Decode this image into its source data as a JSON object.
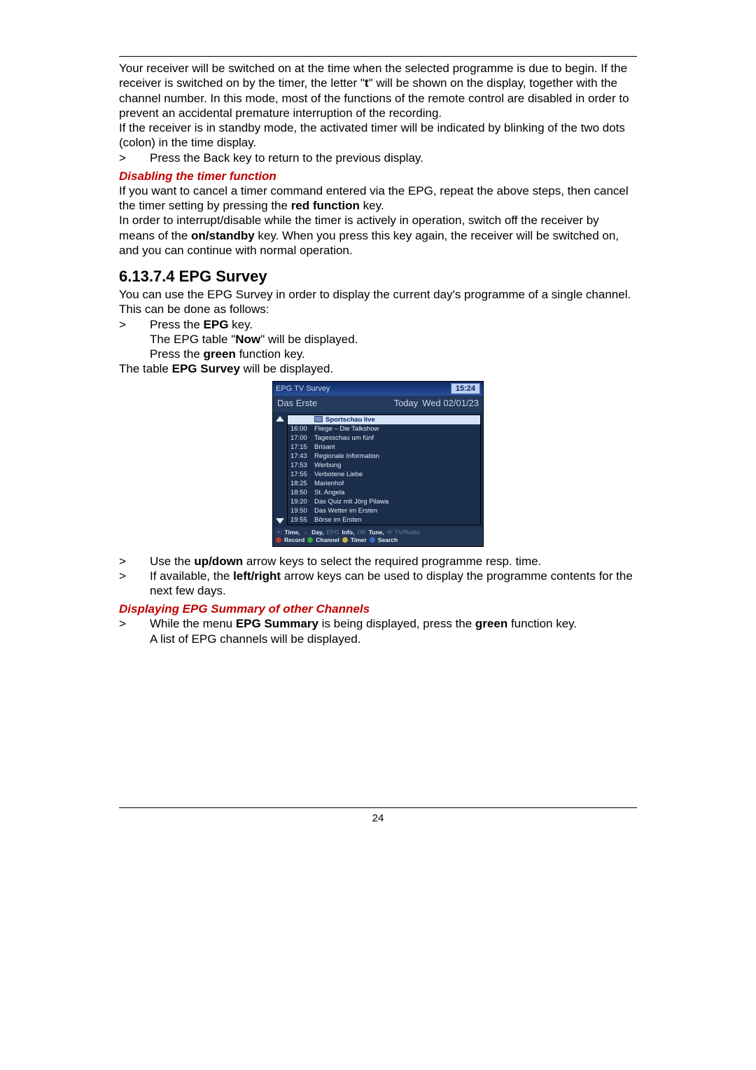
{
  "page_number": "24",
  "para1": "Your receiver will be switched on at the time when the selected programme is due to begin. If the receiver is switched on by the timer, the letter \"",
  "para1_bold_t": "t",
  "para1_after": "\" will be shown on the display, together with the channel number. In this mode, most of the functions of the remote control are disabled in order to prevent an accidental premature interruption of the recording.",
  "para2": "If the receiver is in standby mode, the activated timer will be indicated by blinking of the two dots (colon) in the time display.",
  "back_key_line": "Press the Back key to return to the previous display.",
  "disable_heading": "Disabling the timer function",
  "disable_p1a": "If you want to cancel a timer command entered via the EPG, repeat the above steps, then cancel the timer setting by pressing the ",
  "disable_p1_red": "red function",
  "disable_p1b": " key.",
  "disable_p2a": "In order to interrupt/disable while the timer is actively in operation, switch off the receiver by means of the ",
  "disable_p2_on": "on/standby",
  "disable_p2b": " key. When you press this key again, the receiver will be switched on, and you can continue with normal operation.",
  "section_no": "6.13.7.4 EPG Survey",
  "survey_intro": "You can use the EPG Survey in order to display the current day's programme of a single channel. This can be done as follows:",
  "press_epg_a": "Press the ",
  "press_epg_b": "EPG",
  "press_epg_c": " key.",
  "epg_now_a": "The EPG table \"",
  "epg_now_b": "Now",
  "epg_now_c": "\" will be displayed.",
  "press_green_a": "Press the ",
  "press_green_b": "green",
  "press_green_c": " function key.",
  "table_disp_a": "The table ",
  "table_disp_b": "EPG Survey",
  "table_disp_c": " will be displayed.",
  "epg": {
    "title": "EPG TV Survey",
    "clock": "15:24",
    "channel": "Das Erste",
    "today": "Today",
    "date": "Wed 02/01/23",
    "rows": [
      {
        "time": "",
        "title": "Sportschau live",
        "hl": true
      },
      {
        "time": "16:00",
        "title": "Fliege – Die Talkshow"
      },
      {
        "time": "17:00",
        "title": "Tagesschau um fünf"
      },
      {
        "time": "17:15",
        "title": "Brisant"
      },
      {
        "time": "17:43",
        "title": "Regionale Information"
      },
      {
        "time": "17:53",
        "title": "Werbung"
      },
      {
        "time": "17:55",
        "title": "Verbotene Liebe"
      },
      {
        "time": "18:25",
        "title": "Marienhof"
      },
      {
        "time": "18:50",
        "title": "St. Angela"
      },
      {
        "time": "19:20",
        "title": "Das Quiz mit Jörg Pilawa"
      },
      {
        "time": "19:50",
        "title": "Das Wetter im Ersten"
      },
      {
        "time": "19:55",
        "title": "Börse im Ersten"
      }
    ],
    "legend": {
      "time": "Time,",
      "day": "Day,",
      "epg": "EPG",
      "info": "Info,",
      "ok": "OK",
      "tune": "Tune,",
      "tvradio": "TV/Radio",
      "record": "Record",
      "channel": "Channel",
      "timer": "Timer",
      "search": "Search"
    }
  },
  "use_updown_a": "Use the ",
  "use_updown_b": "up/down",
  "use_updown_c": " arrow keys to select the required programme resp. time.",
  "use_lr_a": "If available, the ",
  "use_lr_b": "left/right",
  "use_lr_c": " arrow keys can be used to display the programme contents for the next few days.",
  "other_ch_heading": "Displaying EPG Summary of other Channels",
  "other_ch_a": "While the menu ",
  "other_ch_b": "EPG Summary",
  "other_ch_c": " is being displayed, press the ",
  "other_ch_d": "green",
  "other_ch_e": " function key.",
  "other_ch_line2": "A list of EPG channels will be displayed."
}
